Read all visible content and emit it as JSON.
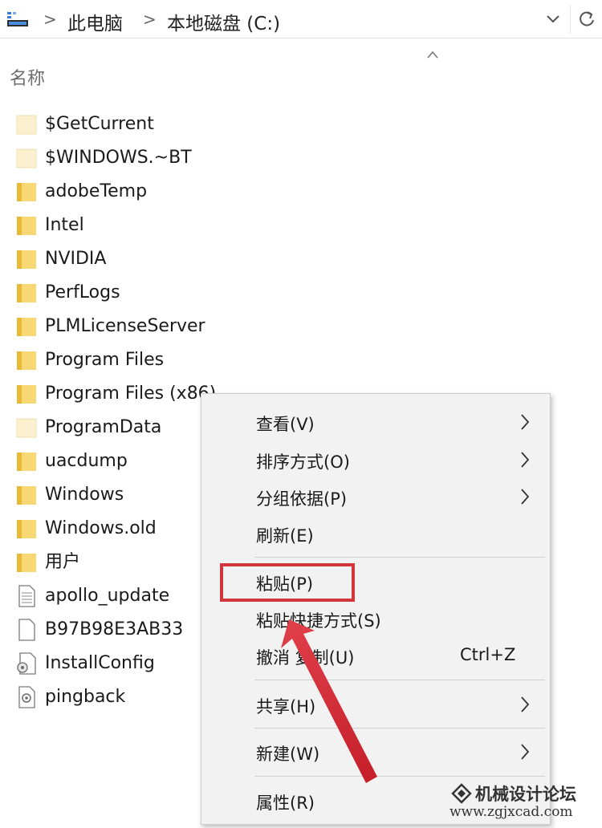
{
  "address_bar": {
    "breadcrumb": [
      "此电脑",
      "本地磁盘 (C:)"
    ],
    "icons": [
      "this-pc-icon",
      "chevron-right-icon",
      "chevron-down-icon",
      "refresh-icon"
    ]
  },
  "file_list": {
    "column_header": "名称",
    "items": [
      {
        "name": "$GetCurrent",
        "type": "folder-faded"
      },
      {
        "name": "$WINDOWS.~BT",
        "type": "folder-faded"
      },
      {
        "name": "adobeTemp",
        "type": "folder"
      },
      {
        "name": "Intel",
        "type": "folder"
      },
      {
        "name": "NVIDIA",
        "type": "folder"
      },
      {
        "name": "PerfLogs",
        "type": "folder"
      },
      {
        "name": "PLMLicenseServer",
        "type": "folder"
      },
      {
        "name": "Program Files",
        "type": "folder"
      },
      {
        "name": "Program Files (x86)",
        "type": "folder"
      },
      {
        "name": "ProgramData",
        "type": "folder-faded"
      },
      {
        "name": "uacdump",
        "type": "folder"
      },
      {
        "name": "Windows",
        "type": "folder"
      },
      {
        "name": "Windows.old",
        "type": "folder"
      },
      {
        "name": "用户",
        "type": "folder"
      },
      {
        "name": "apollo_update",
        "type": "text-file"
      },
      {
        "name": "B97B98E3AB33",
        "type": "blank-file"
      },
      {
        "name": "InstallConfig",
        "type": "config-file"
      },
      {
        "name": "pingback",
        "type": "system-file"
      }
    ]
  },
  "context_menu": {
    "items": [
      {
        "label": "查看(V)",
        "submenu": true
      },
      {
        "label": "排序方式(O)",
        "submenu": true
      },
      {
        "label": "分组依据(P)",
        "submenu": true
      },
      {
        "label": "刷新(E)",
        "submenu": false
      },
      {
        "label": "粘贴(P)",
        "submenu": false,
        "highlighted": true
      },
      {
        "label": "粘贴快捷方式(S)",
        "submenu": false
      },
      {
        "label": "撤消 复制(U)",
        "shortcut": "Ctrl+Z",
        "submenu": false
      },
      {
        "label": "共享(H)",
        "submenu": true
      },
      {
        "label": "新建(W)",
        "submenu": true
      },
      {
        "label": "属性(R)",
        "submenu": false
      }
    ]
  },
  "watermark": {
    "title": "机械设计论坛",
    "url": "www.zgjxcad.com"
  },
  "colors": {
    "folder_yellow": "#f8d775",
    "folder_yellow_dark": "#e8b838",
    "highlight_red": "#d1363a",
    "menu_bg": "#f2f2f2"
  }
}
